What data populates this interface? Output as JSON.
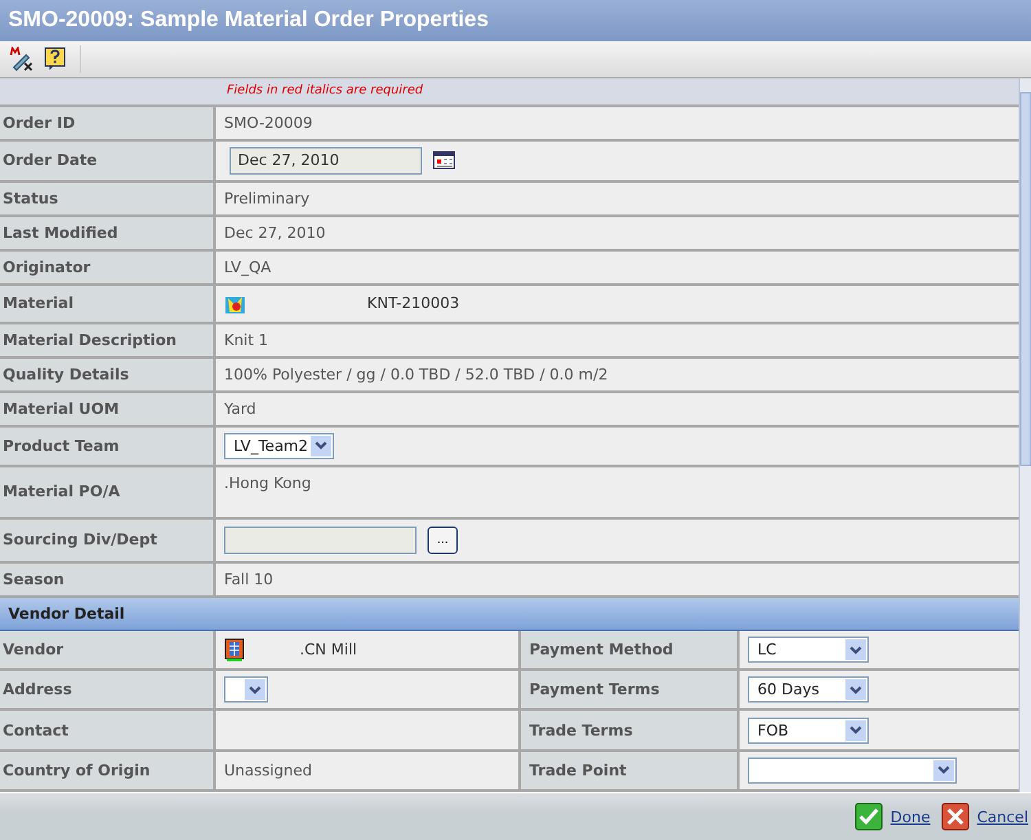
{
  "window": {
    "title": "SMO-20009: Sample Material Order Properties"
  },
  "required_note": "Fields in red italics are required",
  "fields": [
    {
      "label": "Order ID",
      "kind": "text",
      "value": "SMO-20009"
    },
    {
      "label": "Order Date",
      "kind": "date",
      "value": "Dec 27, 2010"
    },
    {
      "label": "Status",
      "kind": "text",
      "value": "Preliminary"
    },
    {
      "label": "Last Modified",
      "kind": "text",
      "value": "Dec 27, 2010"
    },
    {
      "label": "Originator",
      "kind": "text",
      "value": "LV_QA"
    },
    {
      "label": "Material",
      "kind": "material",
      "value": "KNT-210003"
    },
    {
      "label": "Material Description",
      "kind": "text",
      "value": "Knit 1"
    },
    {
      "label": "Quality Details",
      "kind": "text",
      "value": "100% Polyester / gg / 0.0 TBD / 52.0 TBD / 0.0 m/2"
    },
    {
      "label": "Material UOM",
      "kind": "text",
      "value": "Yard"
    },
    {
      "label": "Product Team",
      "kind": "select",
      "value": "LV_Team2"
    },
    {
      "label": "Material PO/A",
      "kind": "multiline",
      "value": ".Hong Kong"
    },
    {
      "label": "Sourcing Div/Dept",
      "kind": "lookup",
      "button": "..."
    },
    {
      "label": "Season",
      "kind": "text",
      "value": "Fall 10"
    }
  ],
  "vendor_section": {
    "title": "Vendor Detail",
    "rows": [
      {
        "left": {
          "label": "Vendor",
          "kind": "vendor",
          "value": ".CN Mill"
        },
        "right": {
          "label": "Payment Method",
          "kind": "select",
          "value": "LC"
        }
      },
      {
        "left": {
          "label": "Address",
          "kind": "select"
        },
        "right": {
          "label": "Payment Terms",
          "kind": "select",
          "value": "60 Days"
        }
      },
      {
        "left": {
          "label": "Contact",
          "kind": "text"
        },
        "right": {
          "label": "Trade Terms",
          "kind": "select",
          "value": "FOB"
        }
      },
      {
        "left": {
          "label": "Country of Origin",
          "kind": "text",
          "value": "Unassigned"
        },
        "right": {
          "label": "Trade Point",
          "kind": "select"
        }
      }
    ]
  },
  "footer": {
    "done": "Done",
    "cancel": "Cancel"
  }
}
